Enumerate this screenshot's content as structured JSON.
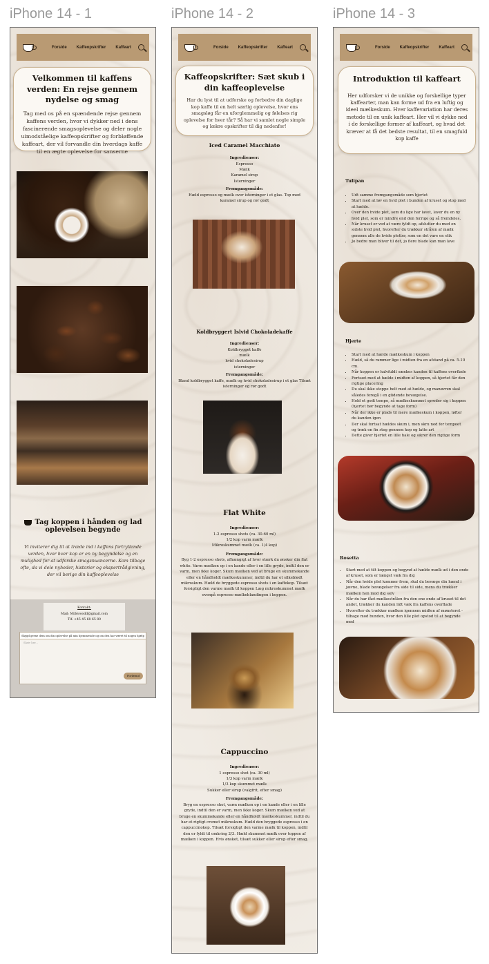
{
  "frames": [
    "iPhone 14 - 1",
    "iPhone 14 - 2",
    "iPhone 14 - 3"
  ],
  "nav": {
    "items": [
      "Forside",
      "Kaffeopskrifter",
      "Kaffeart"
    ]
  },
  "p1": {
    "hero_title": "Velkommen til kaffens verden: En rejse gennem nydelse og smag",
    "hero_text": "Tag med os på en spændende rejse gennem kaffens verden, hvor vi dykker ned i dens fascinerende smagsoplevelse og deler nogle uimodståelige kaffeopskrifter og forbløffende kaffeart, der vil forvandle din hverdags kaffe til en ægte oplevelse for sanserne",
    "cta_title": "Tag koppen i hånden og lad oplevelsen begynde",
    "cta_text": "Vi inviterer dig til at træde ind i kaffens fortryllende verden, hvor hver kop er en ny begyndelse og en mulighed for at udforske smagsnuancerne. Kom tilbage ofte, da vi dele nyheder, historier og ekspertrådgivning, der vil berige din kaffeoplevelse",
    "contact_heading": "Kontakt:",
    "contact_mail": "Mail: Milkwoodd@gmail.com",
    "contact_phone": "Tlf: +45 45 68 65 80",
    "form_label": "Skygd gerne dem om din oplevelse på min hjemmeside og om den har været til nogen hjælp",
    "form_placeholder": "Skriv her...",
    "form_button": "Forlæmd"
  },
  "p2": {
    "hero_title": "Kaffeopskrifter: Sæt skub i din kaffeoplevelse",
    "hero_text": "Har du lyst til at udforske og forbedre din daglige kop kaffe til en helt særlig oplevelse, hvor ens smagsløg får en uforglemmelig og følelses rig oplevelse for hver tår? Så har vi samlet nogle simple og lækre opskrifter til dig nedenfor!",
    "r1": {
      "title": "Iced Caramel Macchiato",
      "ing": "Ingredienser:",
      "items": [
        "Espresso",
        "Mælk",
        "Karamel sirup",
        "Isterninger"
      ],
      "method": "Fremgangsmåde:",
      "steps": "Hæld espresso og mælk over isterninger i et glas. Top med karamel sirup og rør godt"
    },
    "r2": {
      "title": "Koldbryggert Islvid Chokoladekaffe",
      "ing": "Ingredienser:",
      "items": [
        "Koldbrygget kaffe",
        "mælk",
        "hvid chokoladesirup",
        "isterninger"
      ],
      "method": "Fremgangsmåde:",
      "steps": "Bland koldbrygget kaffe, mælk og hvid chokoladesirup i et glas Tilsæt isterninger og rør godt"
    },
    "r3": {
      "title": "Flat White",
      "ing": "Ingredienser:",
      "items": [
        "1-2 espresso shots (ca. 30-60 ml)",
        "1/2 kop varm mælk",
        "Mikroskummet mælk (ca. 1/4 kop)"
      ],
      "method": "Fremgangsmåde:",
      "steps": "Byg 1-2 espresso shots, afhængigt af hvor stærk du ønsker din flat white. Varm mælken op i en kande eller i en lille gryde, indtil den er varm, men ikke koger. Skum mælken ved at bruge en skummekande eller en håndholdt mælkeskummer, indtil du har et silkeblødt mikroskum. Hæld de bryggede espresso shots i en kaffekop. Tilsæt forsigtigt den varme mælk til koppen Læg mikroskummet mælk ovenpå espresso mælkeblandingen i koppen."
    },
    "r4": {
      "title": "Cappuccino",
      "ing": "Ingredienser:",
      "items": [
        "1 espresso shot (ca. 30 ml)",
        "1/3 kop varm mælk",
        "1/3 kop skummet mælk",
        "Sukker eller sirup (valgfrit, efter smag)"
      ],
      "method": "Fremgangsmåde:",
      "steps": "Bryg en espresso shot, varm mælken op i en kande eller i en lille gryde, indtil den er varm, men ikke koger. Skum mælken ved at bruge en skummekande eller en håndholdt mælkeskummer, indtil du har et rigtigt cremet mikroskum. Hæld den bryggede espresso i en cappuccinokop. Tilsæt forsigtigt den varme mælk til koppen, indtil den er fyldt til omkring 2/3. Hæld skummet mælk over toppen af mælken i koppen. Hvis ønsket, tilsæt sukker eller sirup efter smag."
    }
  },
  "p3": {
    "hero_title": "Introduktion til kaffeart",
    "hero_text": "Her udforsker vi de unikke og forskellige typer kaffearter, man kan forme ud fra en luftig og ideel mælkeskum. Hver kaffevariation har deres metode til en unik kaffeart. Her vil vi dykke ned i de forskellige former af kaffeart, og hvad det kræver at få det bedste resultat, til en smagfuld kop kaffe",
    "s1": {
      "title": "Tulipan",
      "items": [
        "Udt samme fremgangsmåde som hjertet",
        "Start med at løv en hvid plet i bunden af kruset og stop med at hælde.",
        "Over den hvide plet, som du lige har lavet, laver du en ny hvid plet, som er mindre end den forrige og så fremdeles.",
        "Når kruset er ved at være fyldt op, afslutter du med en sidste hvid plet, hvorefter du trækker strålen af mælk gennem alle de hvide pletter, som en det vare en stik",
        "Jo bedre man bliver til det, jo flere blade kan man lave"
      ]
    },
    "s2": {
      "title": "Hjerte",
      "items": [
        "Start med at hælde mælkeskum i koppen",
        "Hæld, så du rammer lige i midten fra en afstand på ca. 5-10 cm.",
        "Når koppen er halvfuldt sænkes kanden til kaffens overflade",
        "Fortsæt med at hælde i midten af koppen, så hjertet får den rigtige placering",
        "Du skal ikke stoppe helt med at hælde, og manøvren skal således foregå i en glidende bevægelse.",
        "Hold et godt tempo, så mælkeskummet spreder sig i koppen (hjertet bør begynde at tage form)",
        "Når der ikke er plads til mere mælkeskum i koppen, løfter du kanden igen",
        "Der skal fortsat hældes skum i, men skru ned for tempoet og træk en fin steg gennem kop og latte art",
        "Dette giver hjertet en lille hale og sikrer den rigtige form"
      ]
    },
    "s3": {
      "title": "Rosetta",
      "items": [
        "Start med at tilt koppen og begynd at hælde mælk ud i den ende af kruset, som er længst væk fra dig",
        "Når den hvide plet kommer frem, skal du bevæge din hænd i jævne, blade bevægelser fra side til side, mens du trækker mælken hen mod dig selv",
        "Når du har fået mælkestrålen fra den ene ende af kruset til det andet, trækker du kanden lidt væk fra kaffens overflade",
        "Hvorefter du trækker mælken igennem midten af mønsteret - tilbage mod bunden, hvor den lille plet opstod til at begynde med"
      ]
    }
  },
  "colors": {
    "nav": "#b99a73",
    "accent": "#c8b08e",
    "bg": "#f1ece5"
  }
}
